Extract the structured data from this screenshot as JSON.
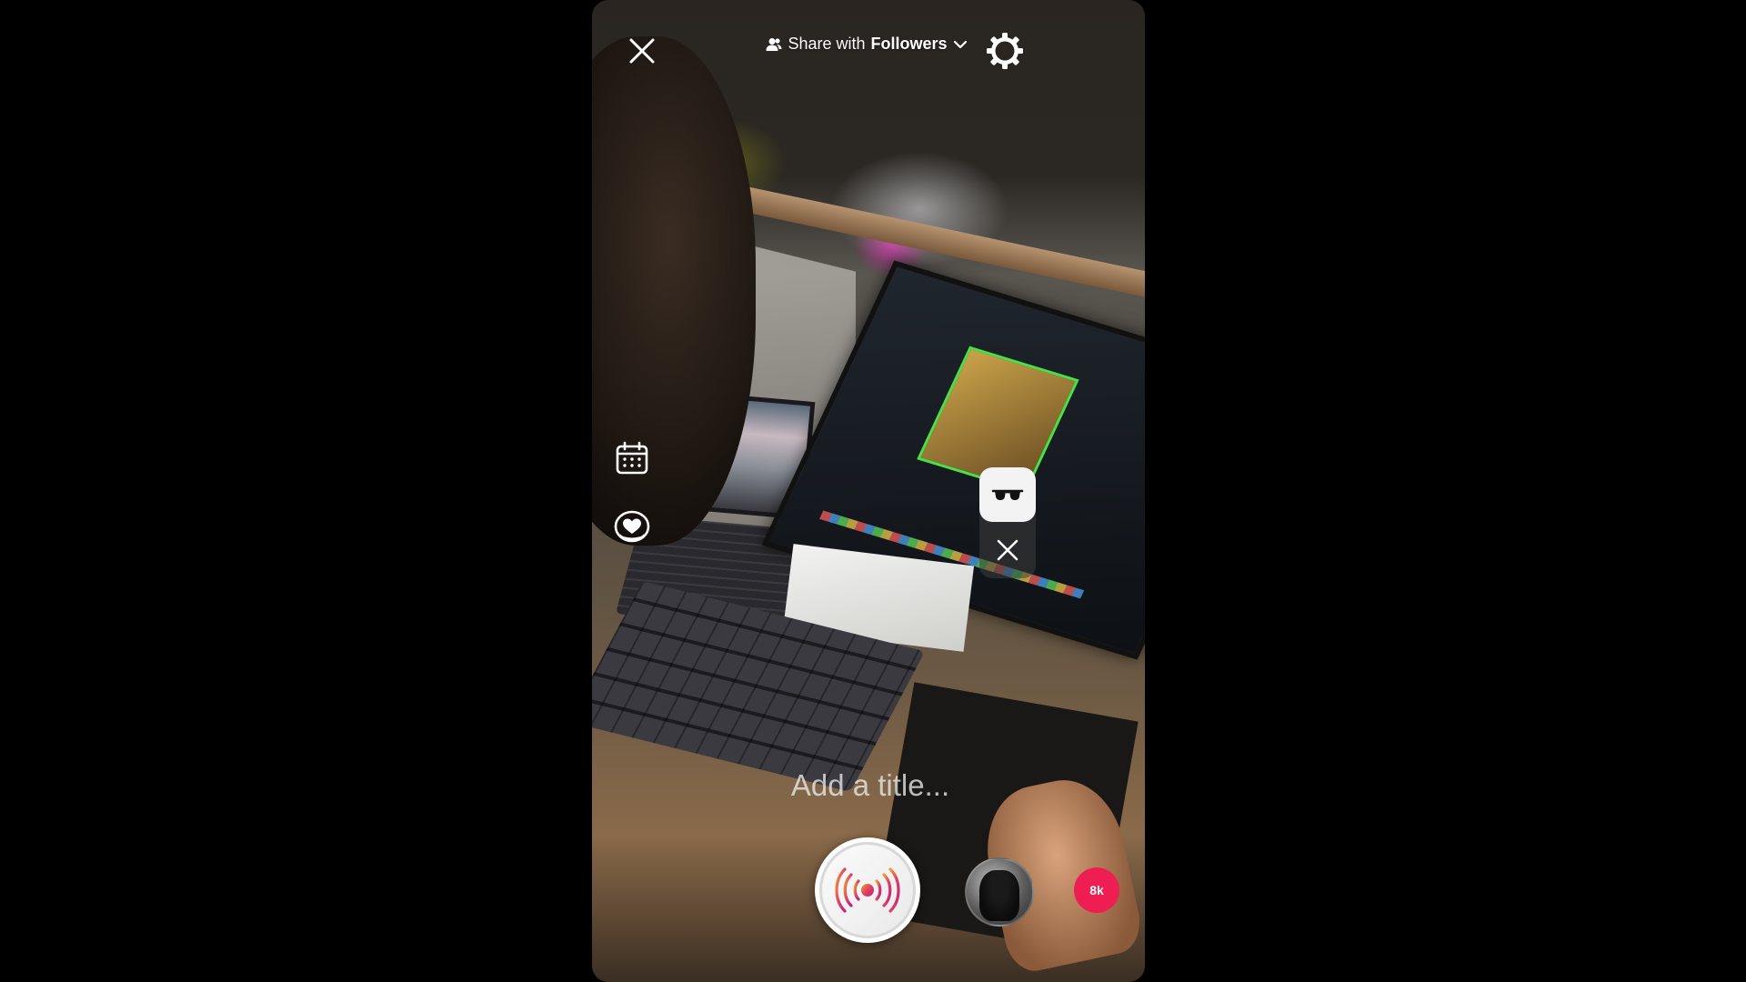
{
  "header": {
    "share_prefix": "Share with",
    "share_audience": "Followers",
    "icons": {
      "close": "close-icon",
      "people": "people-icon",
      "dropdown": "chevron-down-icon",
      "settings": "gear-icon"
    }
  },
  "side_tools": {
    "icons": [
      "calendar-icon",
      "heart-bubble-icon"
    ]
  },
  "effects": {
    "icons": [
      "glasses-icon",
      "close-icon"
    ]
  },
  "title": {
    "placeholder": "Add a title..."
  },
  "bottom": {
    "go_live_icon": "broadcast-icon",
    "viewer_count": "8k"
  },
  "colors": {
    "accent": "#ee1d52",
    "live_gradient_start": "#f0a030",
    "live_gradient_end": "#c02080"
  }
}
